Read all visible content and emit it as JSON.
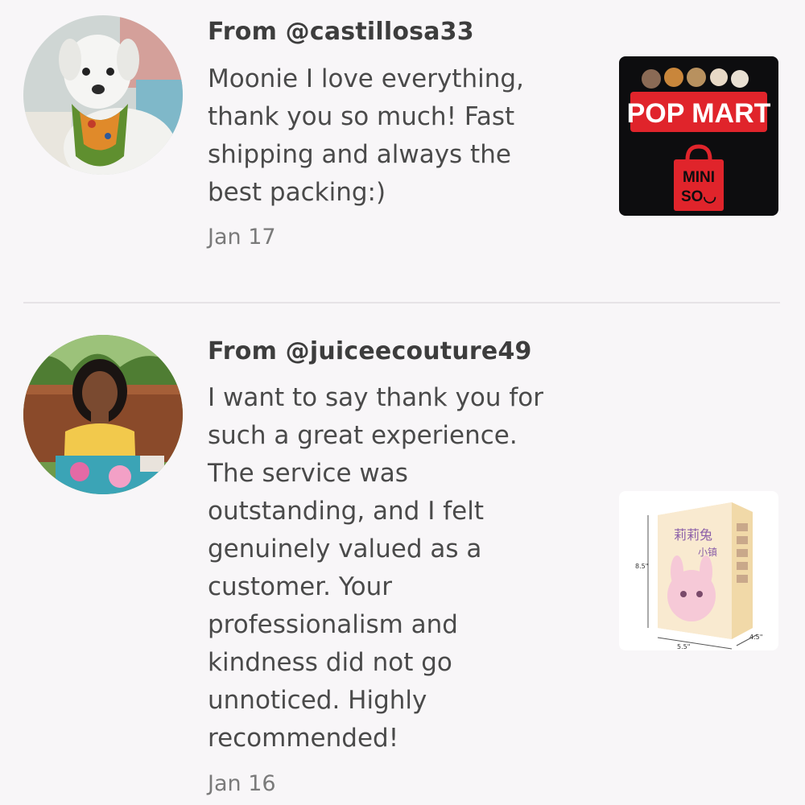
{
  "reviews": [
    {
      "from": "From @castillosa33",
      "message_lines": [
        "Moonie I love everything,",
        "thank you so much! Fast",
        "shipping and always the",
        "best packing:)"
      ],
      "date": "Jan 17",
      "avatar_icon": "dog-avatar",
      "thumb_icon": "popmart-miniso-logo",
      "thumb_text": {
        "brand1": "POP MART",
        "brand2_line1": "MINI",
        "brand2_line2": "SO◡"
      }
    },
    {
      "from": "From @juiceecouture49",
      "message_lines": [
        "I want to say thank you for",
        "such a great experience.",
        "The service was",
        "outstanding, and I felt",
        "genuinely valued as a",
        "customer. Your",
        "professionalism and",
        "kindness did not go",
        "unnoticed. Highly",
        "recommended!"
      ],
      "date": "Jan 16",
      "avatar_icon": "woman-avatar",
      "thumb_icon": "blind-box-product",
      "thumb_text": {
        "dim_h": "8.5\"",
        "dim_w": "5.5\"",
        "dim_d": "4.5\""
      }
    }
  ],
  "colors": {
    "background": "#f8f6f8",
    "username": "#3d3d3d",
    "message": "#4a4a4a",
    "date": "#7a7a7a",
    "divider": "#e6e3e6",
    "popmart_red": "#e0242b"
  }
}
